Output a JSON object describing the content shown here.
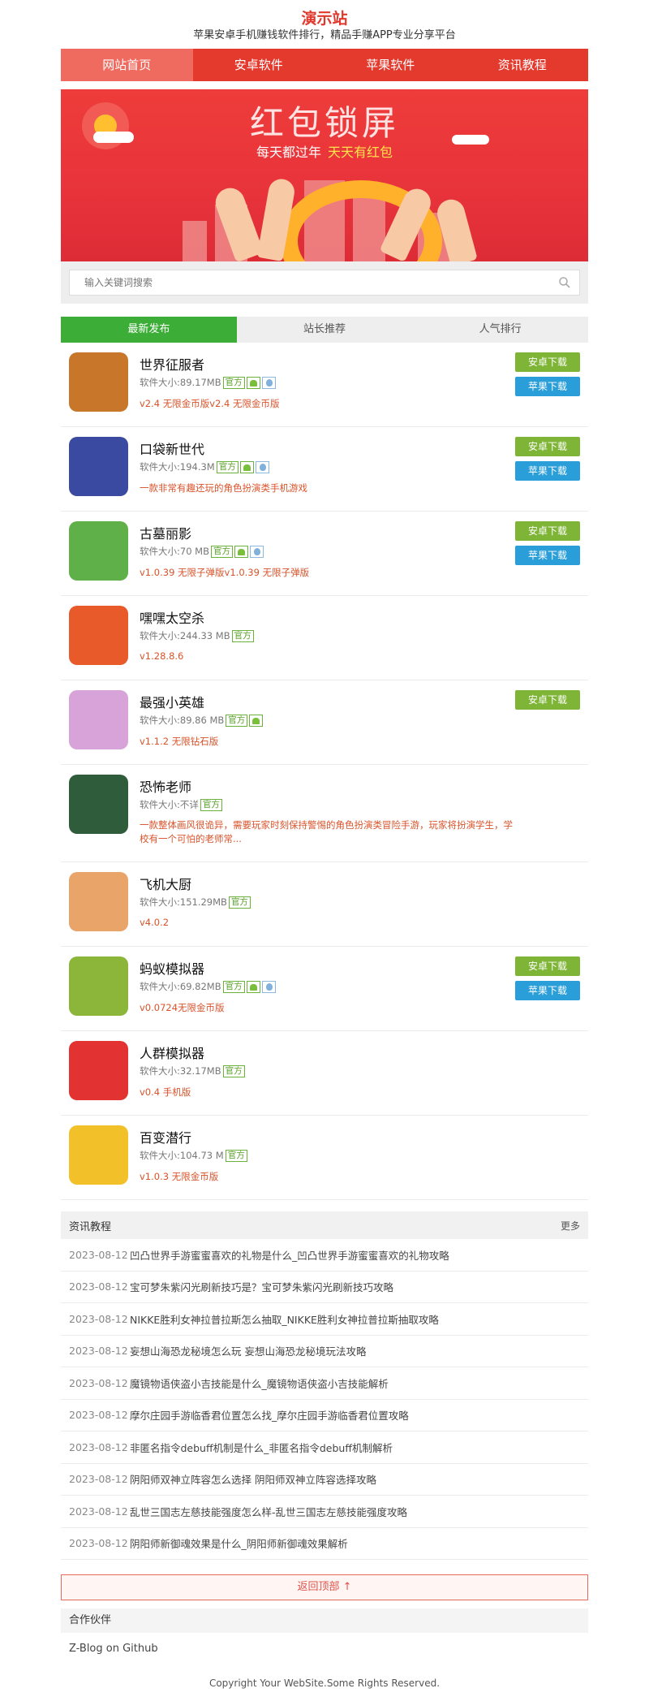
{
  "site": {
    "title": "演示站",
    "subtitle": "苹果安卓手机赚钱软件排行，精品手赚APP专业分享平台"
  },
  "nav": {
    "items": [
      {
        "label": "网站首页",
        "active": true
      },
      {
        "label": "安卓软件",
        "active": false
      },
      {
        "label": "苹果软件",
        "active": false
      },
      {
        "label": "资讯教程",
        "active": false
      }
    ]
  },
  "banner": {
    "title": "红包锁屏",
    "sub_white": "每天都过年",
    "sub_yellow": "天天有红包"
  },
  "search": {
    "placeholder": "输入关键词搜索"
  },
  "tabs": [
    {
      "label": "最新发布",
      "active": true
    },
    {
      "label": "站长推荐",
      "active": false
    },
    {
      "label": "人气排行",
      "active": false
    }
  ],
  "apps": [
    {
      "name": "世界征服者",
      "size": "软件大小:89.17MB",
      "badge": "官方",
      "android": true,
      "ios": true,
      "ver": "v2.4 无限金币版v2.4 无限金币版",
      "btn_android": "安卓下载",
      "btn_apple": "苹果下载",
      "icon_color": "#c8772a"
    },
    {
      "name": "口袋新世代",
      "size": "软件大小:194.3M",
      "badge": "官方",
      "android": true,
      "ios": true,
      "ver": "一款非常有趣还玩的角色扮演类手机游戏",
      "btn_android": "安卓下载",
      "btn_apple": "苹果下载",
      "icon_color": "#3a4aa0"
    },
    {
      "name": "古墓丽影",
      "size": "软件大小:70 MB",
      "badge": "官方",
      "android": true,
      "ios": true,
      "ver": "v1.0.39 无限子弹版v1.0.39 无限子弹版",
      "btn_android": "安卓下载",
      "btn_apple": "苹果下载",
      "icon_color": "#5fb048"
    },
    {
      "name": "嘿嘿太空杀",
      "size": "软件大小:244.33 MB",
      "badge": "官方",
      "android": false,
      "ios": false,
      "ver": "v1.28.8.6",
      "icon_color": "#e85a2a"
    },
    {
      "name": "最强小英雄",
      "size": "软件大小:89.86 MB",
      "badge": "官方",
      "android": true,
      "ios": false,
      "ver": "v1.1.2 无限钻石版",
      "btn_android": "安卓下载",
      "icon_color": "#d7a3d8"
    },
    {
      "name": "恐怖老师",
      "size": "软件大小:不详",
      "badge": "官方",
      "android": false,
      "ios": false,
      "desc": "一款整体画风很诡异，需要玩家时刻保持警惕的角色扮演类冒险手游，玩家将扮演学生，学校有一个可怕的老师常...",
      "icon_color": "#2f5c3a"
    },
    {
      "name": "飞机大厨",
      "size": "软件大小:151.29MB",
      "badge": "官方",
      "android": false,
      "ios": false,
      "ver": "v4.0.2",
      "icon_color": "#e9a46a"
    },
    {
      "name": "蚂蚁模拟器",
      "size": "软件大小:69.82MB",
      "badge": "官方",
      "android": true,
      "ios": true,
      "ver": "v0.0724无限金币版",
      "btn_android": "安卓下载",
      "btn_apple": "苹果下载",
      "icon_color": "#8bb63a"
    },
    {
      "name": "人群模拟器",
      "size": "软件大小:32.17MB",
      "badge": "官方",
      "android": false,
      "ios": false,
      "ver": "v0.4 手机版",
      "icon_color": "#e23232"
    },
    {
      "name": "百变潜行",
      "size": "软件大小:104.73 M",
      "badge": "官方",
      "android": false,
      "ios": false,
      "ver": "v1.0.3 无限金币版",
      "icon_color": "#f2c12a"
    }
  ],
  "news": {
    "title": "资讯教程",
    "more": "更多",
    "items": [
      {
        "date": "2023-08-12",
        "title": "凹凸世界手游蜜蜜喜欢的礼物是什么_凹凸世界手游蜜蜜喜欢的礼物攻略"
      },
      {
        "date": "2023-08-12",
        "title": "宝可梦朱紫闪光刷新技巧是？宝可梦朱紫闪光刷新技巧攻略"
      },
      {
        "date": "2023-08-12",
        "title": "NIKKE胜利女神拉普拉斯怎么抽取_NIKKE胜利女神拉普拉斯抽取攻略"
      },
      {
        "date": "2023-08-12",
        "title": "妄想山海恐龙秘境怎么玩 妄想山海恐龙秘境玩法攻略"
      },
      {
        "date": "2023-08-12",
        "title": "魔镜物语侠盗小吉技能是什么_魔镜物语侠盗小吉技能解析"
      },
      {
        "date": "2023-08-12",
        "title": "摩尔庄园手游临香君位置怎么找_摩尔庄园手游临香君位置攻略"
      },
      {
        "date": "2023-08-12",
        "title": "非匿名指令debuff机制是什么_非匿名指令debuff机制解析"
      },
      {
        "date": "2023-08-12",
        "title": "阴阳师双神立阵容怎么选择 阴阳师双神立阵容选择攻略"
      },
      {
        "date": "2023-08-12",
        "title": "乱世三国志左慈技能强度怎么样-乱世三国志左慈技能强度攻略"
      },
      {
        "date": "2023-08-12",
        "title": "阴阳师新御魂效果是什么_阴阳师新御魂效果解析"
      }
    ]
  },
  "back_top": "返回顶部 ↑",
  "partners": {
    "title": "合作伙伴",
    "link": "Z-Blog on Github"
  },
  "footer": "Copyright Your WebSite.Some Rights Reserved."
}
